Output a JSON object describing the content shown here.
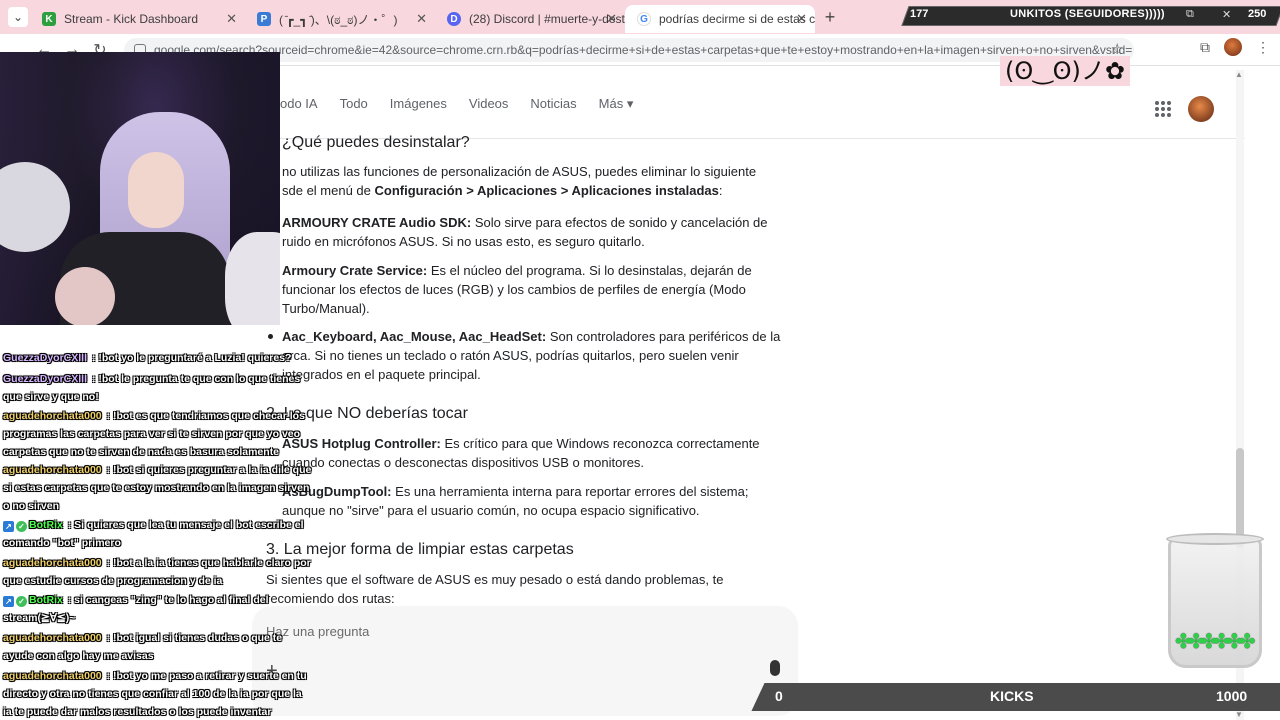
{
  "tabs": [
    {
      "label": "Stream - Kick Dashboard",
      "favicon": "K",
      "favicon_color": "#2d9f3e"
    },
    {
      "label": "( ̄┏_┓ ̄)、\\(ಠ_ಠ)ノ・゜)",
      "favicon": "P",
      "favicon_color": "#3a7bd5"
    },
    {
      "label": "(28) Discord | #muerte-y-destr",
      "favicon": "D",
      "favicon_color": "#5865f2"
    },
    {
      "label": "podrías decirme si de estas carp",
      "favicon": "G",
      "favicon_color": "#4285f4"
    }
  ],
  "address_bar": {
    "url": "google.com/search?sourceid=chrome&ie=42&source=chrome.crn.rb&q=podrías+decirme+si+de+estas+carpetas+que+te+estoy+mostrando+en+la+imagen+sirven+o+no+sirven&vsrid="
  },
  "google_nav": {
    "items": [
      "odo IA",
      "Todo",
      "Imágenes",
      "Videos",
      "Noticias",
      "Más ▾"
    ]
  },
  "kaomoji": "(ʘ‿ʘ)ノ✿",
  "article": {
    "heading1": "¿Qué puedes desinstalar?",
    "intro_line1": "no utilizas las funciones de personalización de ASUS, puedes eliminar lo siguiente",
    "intro_line2_pre": "sde el menú de ",
    "intro_line2_bold": "Configuración > Aplicaciones > Aplicaciones instaladas",
    "intro_line2_post": ":",
    "items1": [
      {
        "title": "ARMOURY CRATE Audio SDK:",
        "line1": " Solo sirve para efectos de sonido y cancelación de",
        "line2": "ruido en micrófonos ASUS. Si no usas esto, es seguro quitarlo.",
        "line3": ""
      },
      {
        "title": "Armoury Crate Service:",
        "line1": " Es el núcleo del programa. Si lo desinstalas, dejarán de",
        "line2": "funcionar los efectos de luces (RGB) y los cambios de perfiles de energía (Modo",
        "line3": "Turbo/Manual)."
      },
      {
        "title": "Aac_Keyboard, Aac_Mouse, Aac_HeadSet:",
        "line1": " Son controladores para periféricos de la",
        "line2": "arca. Si no tienes un teclado o ratón ASUS, podrías quitarlos, pero suelen venir",
        "line3": "integrados en el paquete principal."
      }
    ],
    "heading2": "2. Lo que NO deberías tocar",
    "items2": [
      {
        "title": "ASUS Hotplug Controller:",
        "line1": " Es crítico para que Windows reconozca correctamente",
        "line2": "cuando conectas o desconectas dispositivos USB o monitores."
      },
      {
        "title": "AsBugDumpTool:",
        "line1": " Es una herramienta interna para reportar errores del sistema;",
        "line2": "aunque no \"sirve\" para el usuario común, no ocupa espacio significativo."
      }
    ],
    "heading3": "3. La mejor forma de limpiar estas carpetas",
    "outro_line1": "Si sientes que el software de ASUS es muy pesado o está dando problemas, te",
    "outro_line2": "recomiendo dos rutas:"
  },
  "ask": {
    "placeholder": "Haz una pregunta"
  },
  "chat": {
    "messages": [
      {
        "user": "GuezzaDyorCXIII",
        "text": " : !bot yo le preguntaré a Luzia! quieres?",
        "cls": "u-guezza",
        "badges": []
      },
      {
        "user": "GuezzaDyorCXIII",
        "text": " : !bot le pregunta te que con lo que tienes que sirve y que no!",
        "cls": "u-guezza",
        "badges": []
      },
      {
        "user": "aguadehorchata000",
        "text": " : !bot es que tendriamos que checar los programas las carpetas para ver si te sirven por que yo veo carpetas que no te sirven de nada es basura solamente",
        "cls": "u-agua",
        "badges": []
      },
      {
        "user": "aguadehorchata000",
        "text": " : !bot si quieres preguntar a la ia dile que si estas carpetas que te estoy mostrando en la imagen sirven o no sirven",
        "cls": "u-agua",
        "badges": []
      },
      {
        "user": "BotRix",
        "text": " : Si quieres que lea tu mensaje el bot escribe el comando \"bot\" primero",
        "cls": "u-botrix",
        "badges": [
          "bot",
          "verified"
        ]
      },
      {
        "user": "aguadehorchata000",
        "text": " : !bot a la ia tienes que hablarle claro por que estudie cursos de programacion y de ia",
        "cls": "u-agua",
        "badges": []
      },
      {
        "user": "BotRix",
        "text": " : si cangeas \"zing\" te lo hago al final del stream(≧∀≦)~",
        "cls": "u-botrix",
        "badges": [
          "bot",
          "verified"
        ]
      },
      {
        "user": "aguadehorchata000",
        "text": " : !bot igual si tienes dudas o que te ayude con algo hay me avisas",
        "cls": "u-agua",
        "badges": []
      },
      {
        "user": "aguadehorchata000",
        "text": " : !bot yo me paso a retirar y suerte en tu directo y otra no tienes que confiar al 100 de la ia por que la ia te puede dar malos resultados o los puede inventar",
        "cls": "u-agua",
        "badges": []
      }
    ]
  },
  "follow_goal": {
    "current": "177",
    "title": "UNKITOS (SEGUIDORES)))))",
    "goal": "250"
  },
  "kicks": {
    "min": "0",
    "label": "KICKS",
    "max": "1000"
  },
  "jar": {
    "gems": "✤✤✤✤✤✤"
  }
}
